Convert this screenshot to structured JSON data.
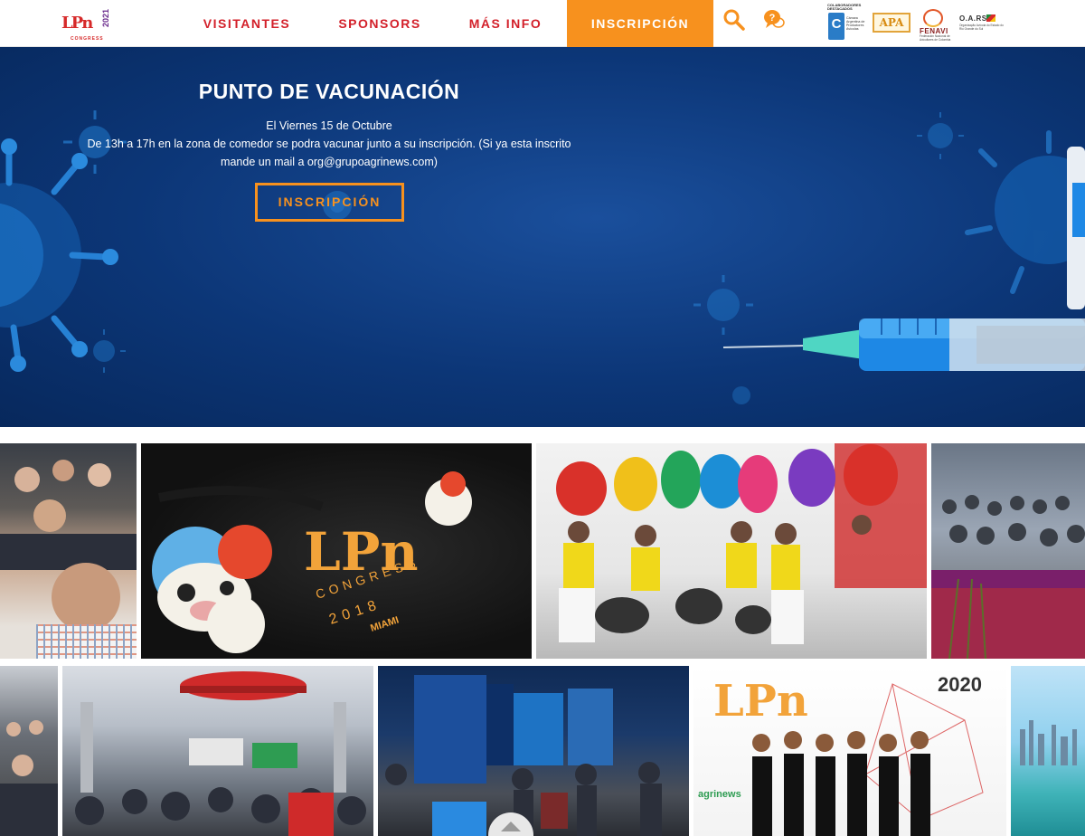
{
  "header": {
    "logo_text": "LPn",
    "logo_year": "2021",
    "logo_sub": "CONGRESS",
    "nav": [
      {
        "label": "VISITANTES"
      },
      {
        "label": "SPONSORS"
      },
      {
        "label": "MÁS INFO"
      },
      {
        "label": "INSCRIPCIÓN",
        "active": true
      }
    ],
    "icons": [
      "search-icon",
      "chat-help-icon"
    ],
    "colaboradores_label": "COLABORADORES DESTACADOS",
    "partners": [
      {
        "name": "C",
        "caption": "Cámara Argentina de Productores Avícolas"
      },
      {
        "name": "APA"
      },
      {
        "name": "FENAVI",
        "caption": "Federación Nacional de Avicultores de Colombia"
      },
      {
        "name": "O.A.RS",
        "caption": "Organização Avícola do Estado do Rio Grande do Sul"
      }
    ]
  },
  "hero": {
    "title": "PUNTO DE VACUNACIÓN",
    "line1": "El Viernes 15 de Octubre",
    "line2": "De 13h a 17h en la zona de comedor se podra vacunar junto a su inscripción. (Si ya esta inscrito",
    "line3": "mande un mail a org@grupoagrinews.com)",
    "cta_label": "INSCRIPCIÓN"
  },
  "gallery": {
    "badge_lpn": "LPn",
    "badge_congress": "CONGRESS",
    "badge_year": "2018",
    "badge_city": "MIAMI",
    "year_2020": "2020",
    "brand_agrinews": "agrinews"
  },
  "colors": {
    "accent_orange": "#f7911e",
    "nav_red": "#d3202a",
    "hero_blue": "#0c3677"
  }
}
